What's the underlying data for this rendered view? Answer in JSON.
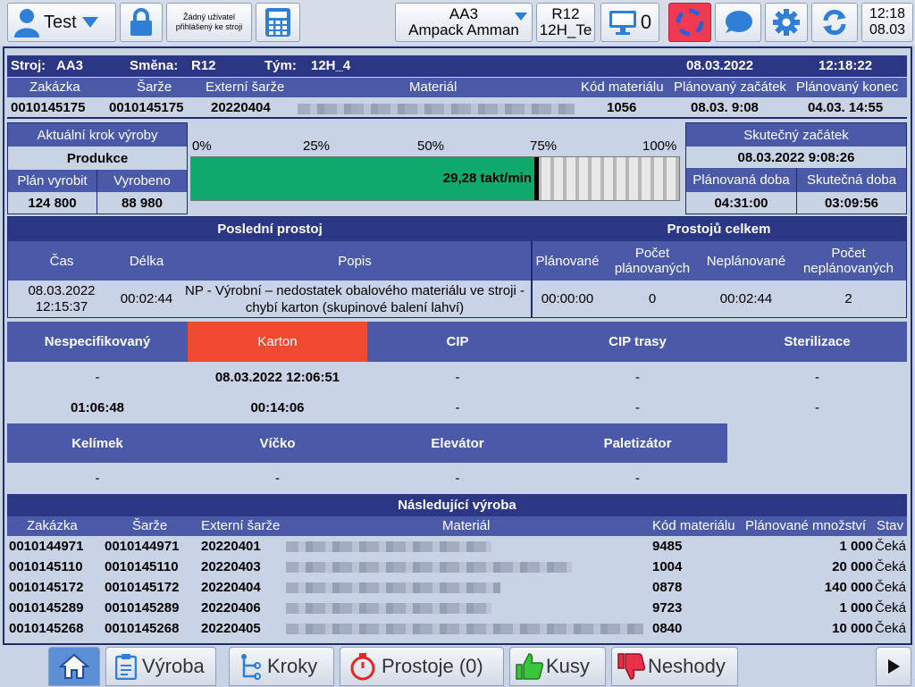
{
  "topbar": {
    "user_label": "Test",
    "login_note": "Žádný uživatel přihlášený ke stroji",
    "machine_line1": "AA3",
    "machine_line2": "Ampack Amman",
    "shift_line1": "R12",
    "shift_line2": "12H_Te",
    "monitor_count": "0",
    "clock_time": "12:18",
    "clock_date": "08.03"
  },
  "info": {
    "machine_label": "Stroj:",
    "machine_value": "AA3",
    "shift_label": "Směna:",
    "shift_value": "R12",
    "team_label": "Tým:",
    "team_value": "12H_4",
    "date": "08.03.2022",
    "time": "12:18:22"
  },
  "order": {
    "headers": [
      "Zakázka",
      "Šarže",
      "Externí šarže",
      "Materiál",
      "Kód materiálu",
      "Plánovaný začátek",
      "Plánovaný konec"
    ],
    "zakazka": "0010145175",
    "sarze": "0010145175",
    "ext_sarze": "20220404",
    "kod": "1056",
    "plan_start": "08.03. 9:08",
    "plan_end": "04.03. 14:55"
  },
  "progress": {
    "step_label": "Aktuální krok výroby",
    "step_value": "Produkce",
    "plan_label": "Plán vyrobit",
    "plan_value": "124 800",
    "made_label": "Vyrobeno",
    "made_value": "88 980",
    "ticks": [
      "0%",
      "25%",
      "50%",
      "75%",
      "100%"
    ],
    "fraction": 0.713,
    "rate": "29,28 takt/min",
    "real_start_label": "Skutečný začátek",
    "real_start_value": "08.03.2022 9:08:26",
    "plan_dur_label": "Plánovaná doba",
    "plan_dur_value": "04:31:00",
    "real_dur_label": "Skutečná doba",
    "real_dur_value": "03:09:56"
  },
  "downtime": {
    "last_title": "Poslední prostoj",
    "total_title": "Prostojů celkem",
    "h_time": "Čas",
    "h_len": "Délka",
    "h_desc": "Popis",
    "h_planned": "Plánované",
    "h_planned_count": "Počet plánovaných",
    "h_unplanned": "Neplánované",
    "h_unplanned_count": "Počet neplánovaných",
    "time": "08.03.2022 12:15:37",
    "length": "00:02:44",
    "desc": "NP - Výrobní – nedostatek obalového materiálu ve stroji - chybí karton (skupinové balení lahví)",
    "planned": "00:00:00",
    "planned_count": "0",
    "unplanned": "00:02:44",
    "unplanned_count": "2"
  },
  "categories_row1": [
    {
      "name": "Nespecifikovaný",
      "date": "-",
      "dur": "01:06:48"
    },
    {
      "name": "Karton",
      "date": "08.03.2022 12:06:51",
      "dur": "00:14:06"
    },
    {
      "name": "CIP",
      "date": "-",
      "dur": "-"
    },
    {
      "name": "CIP trasy",
      "date": "-",
      "dur": "-"
    },
    {
      "name": "Sterilizace",
      "date": "-",
      "dur": "-"
    }
  ],
  "categories_row2": [
    {
      "name": "Kelímek",
      "val": "-"
    },
    {
      "name": "Víčko",
      "val": "-"
    },
    {
      "name": "Elevátor",
      "val": "-"
    },
    {
      "name": "Paletizátor",
      "val": "-"
    }
  ],
  "next": {
    "title": "Následující výroba",
    "headers": [
      "Zakázka",
      "Šarže",
      "Externí šarže",
      "Materiál",
      "Kód materiálu",
      "Plánované množství",
      "Stav"
    ],
    "rows": [
      {
        "zak": "0010144971",
        "sar": "0010144971",
        "ext": "20220401",
        "kod": "9485",
        "qty": "1 000",
        "stav": "Čeká"
      },
      {
        "zak": "0010145110",
        "sar": "0010145110",
        "ext": "20220403",
        "kod": "1004",
        "qty": "20 000",
        "stav": "Čeká"
      },
      {
        "zak": "0010145172",
        "sar": "0010145172",
        "ext": "20220404",
        "kod": "0878",
        "qty": "140 000",
        "stav": "Čeká"
      },
      {
        "zak": "0010145289",
        "sar": "0010145289",
        "ext": "20220406",
        "kod": "9723",
        "qty": "1 000",
        "stav": "Čeká"
      },
      {
        "zak": "0010145268",
        "sar": "0010145268",
        "ext": "20220405",
        "kod": "0840",
        "qty": "10 000",
        "stav": "Čeká"
      }
    ]
  },
  "tabs": {
    "vyroba": "Výroba",
    "kroky": "Kroky",
    "prostoje": "Prostoje (0)",
    "kusy": "Kusy",
    "neshody": "Neshody"
  },
  "colors": {
    "accent": "#2b3684",
    "progress": "#0fa96b",
    "active_category": "#f04a32"
  }
}
